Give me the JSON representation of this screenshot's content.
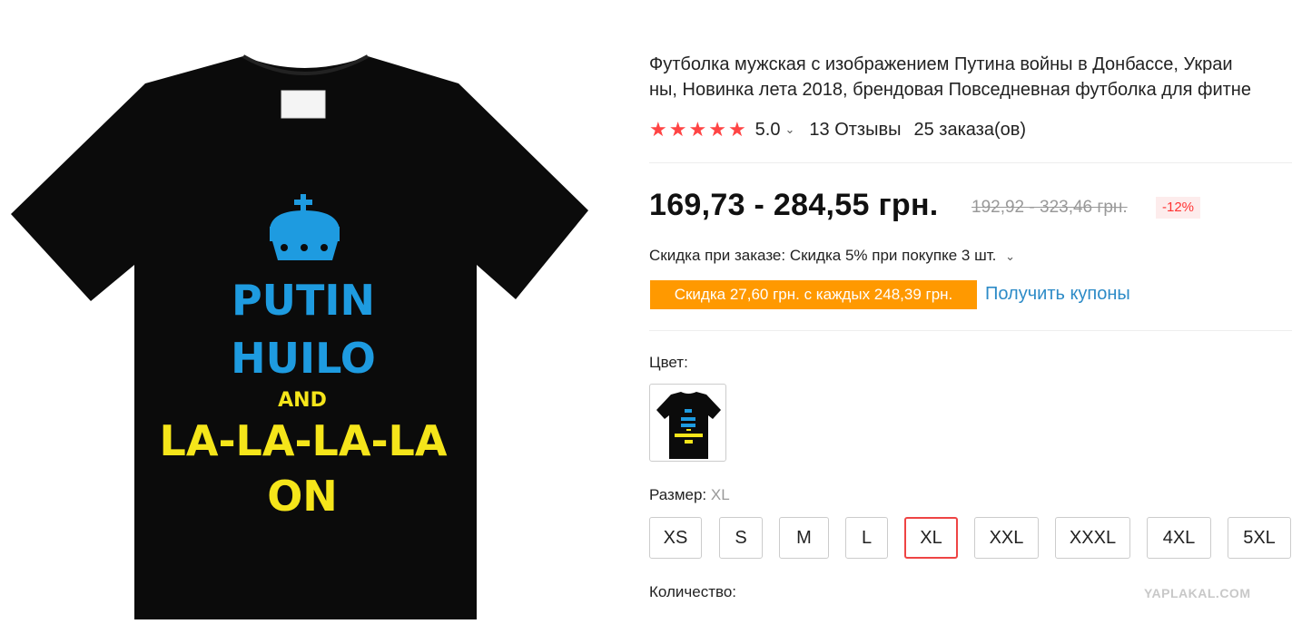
{
  "product": {
    "title_line1": "Футболка мужская с изображением Путина войны в Донбассе, Украи",
    "title_line2": "ны, Новинка лета 2018, брендовая Повседневная футболка для фитне",
    "image_text": {
      "line1": "PUTIN",
      "line2": "HUILO",
      "line3": "AND",
      "line4": "LA-LA-LA-LA",
      "line5": "ON"
    },
    "rating_value": "5.0",
    "stars": 5,
    "reviews": "13 Отзывы",
    "orders": "25 заказа(ов)",
    "price": "169,73 - 284,55 грн.",
    "old_price": "192,92 - 323,46 грн.",
    "discount": "-12%",
    "bulk_discount": "Скидка при заказе: Скидка 5% при покупке 3 шт.",
    "coupon_badge": "Скидка 27,60 грн. с каждых 248,39 грн.",
    "get_coupons": "Получить купоны",
    "color_label": "Цвет:",
    "size_label": "Размер:",
    "size_selected": "XL",
    "sizes": [
      "XS",
      "S",
      "M",
      "L",
      "XL",
      "XXL",
      "XXXL",
      "4XL",
      "5XL"
    ],
    "quantity_label": "Количество:"
  },
  "icons": {
    "star": "star-icon",
    "chevron": "chevron-down-icon"
  },
  "colors": {
    "star": "#ff4444",
    "coupon_bg": "#ff9900",
    "link": "#2d8bc7",
    "selected_border": "#ee4444",
    "shirt_blue": "#1e9be0",
    "shirt_yellow": "#f5e51a"
  },
  "watermark": "YAPLAKAL.COM"
}
